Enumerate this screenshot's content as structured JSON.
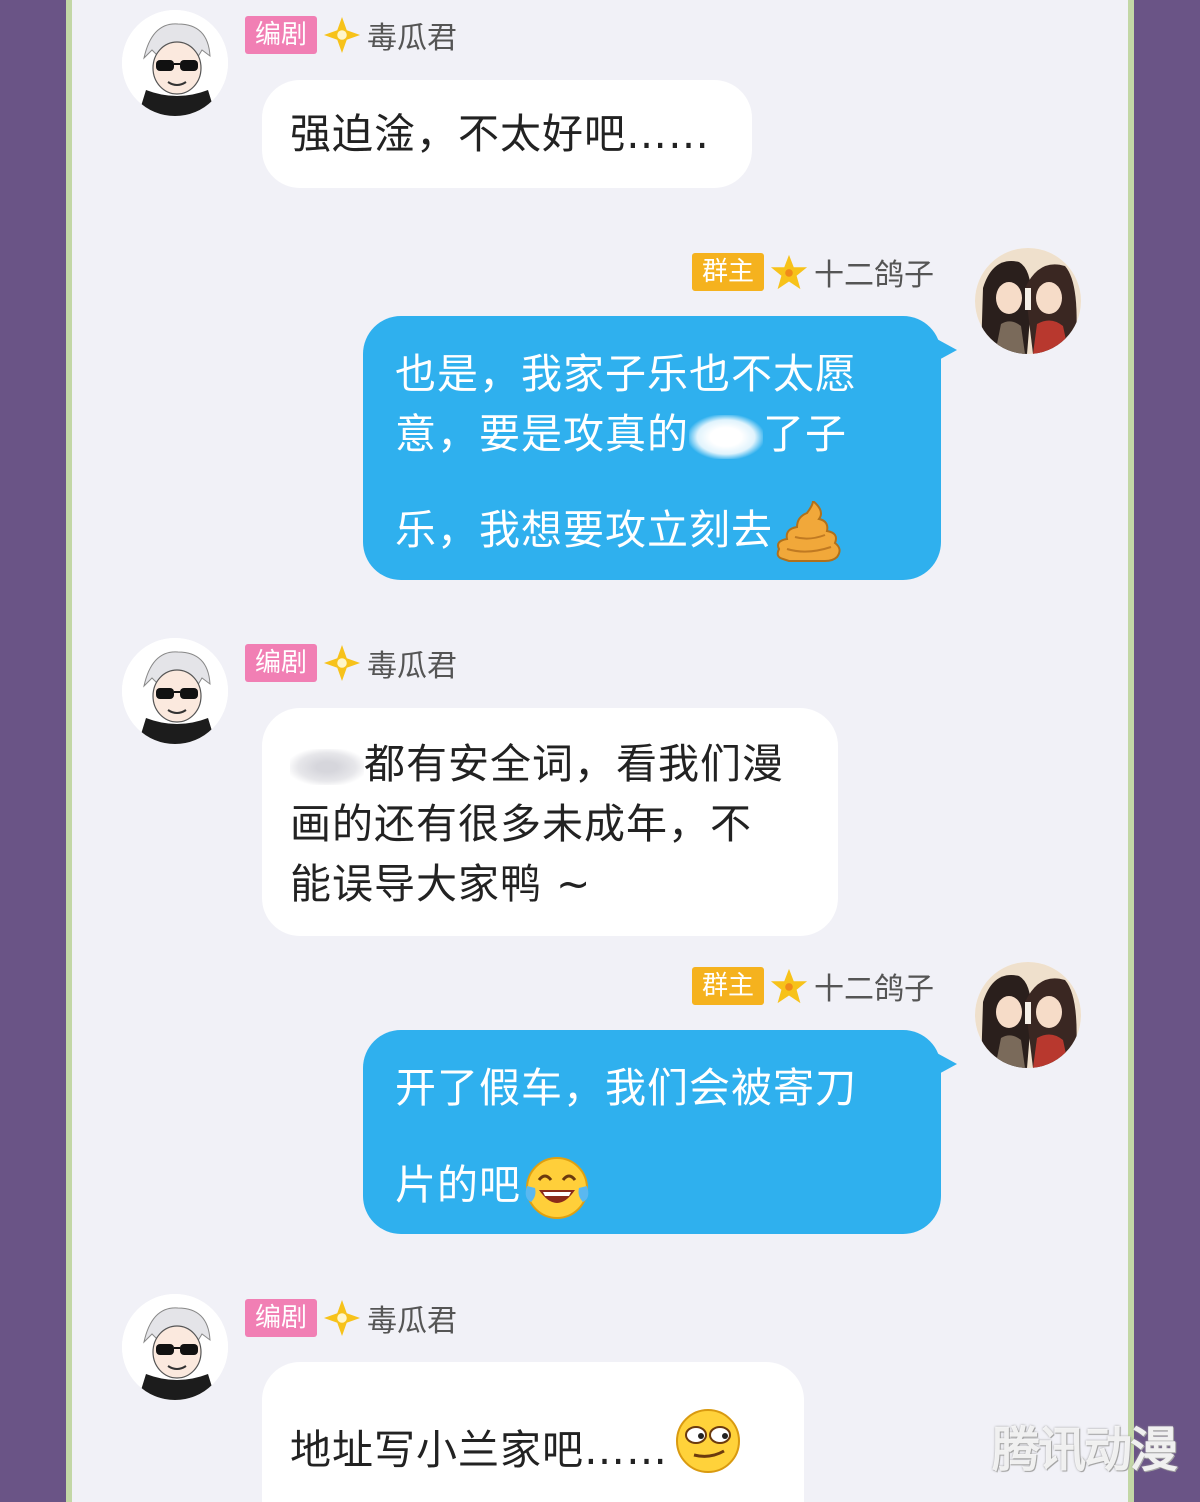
{
  "messages": [
    {
      "side": "left",
      "badge": "编剧",
      "name": "毒瓜君",
      "lines": [
        "强迫淦，不太好吧……"
      ]
    },
    {
      "side": "right",
      "badge": "群主",
      "name": "十二鸽子",
      "line1": "也是，我家子乐也不太愿",
      "line2a": "意，要是攻真的",
      "line2b": "了子",
      "line3": "乐，我想要攻立刻去"
    },
    {
      "side": "left",
      "badge": "编剧",
      "name": "毒瓜君",
      "line1": "都有安全词，看我们漫",
      "line2": "画的还有很多未成年，不",
      "line3": "能误导大家鸭 ~"
    },
    {
      "side": "right",
      "badge": "群主",
      "name": "十二鸽子",
      "line1": "开了假车，我们会被寄刀",
      "line2": "片的吧"
    },
    {
      "side": "left",
      "badge": "编剧",
      "name": "毒瓜君",
      "lines": [
        "地址写小兰家吧……"
      ]
    }
  ],
  "colors": {
    "editor_badge": "#f17fb4",
    "owner_badge": "#f5b21e",
    "right_bubble": "#2fb0ee",
    "background": "#6a5486"
  },
  "icons": {
    "editor_star": "diamond-star-icon",
    "owner_star": "star-icon",
    "poop": "poop-emoji",
    "laugh": "tears-of-joy-emoji",
    "smirk": "smirk-emoji"
  },
  "watermark": "腾讯动漫"
}
